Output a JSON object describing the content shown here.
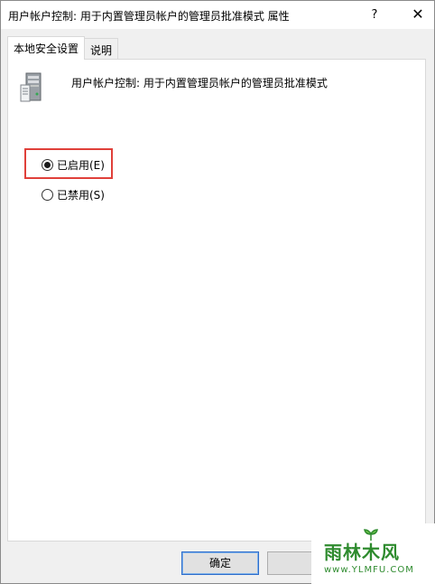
{
  "window": {
    "title": "用户帐户控制: 用于内置管理员帐户的管理员批准模式 属性",
    "help_label": "?",
    "close_label": "✕"
  },
  "tabs": [
    {
      "label": "本地安全设置",
      "active": true
    },
    {
      "label": "说明",
      "active": false
    }
  ],
  "policy": {
    "icon": "server-icon",
    "title": "用户帐户控制: 用于内置管理员帐户的管理员批准模式"
  },
  "options": [
    {
      "label": "已启用(E)",
      "checked": true
    },
    {
      "label": "已禁用(S)",
      "checked": false
    }
  ],
  "buttons": {
    "ok_label": "确定"
  },
  "watermark": {
    "main": "雨林木风",
    "url": "www.YLMFU.COM"
  },
  "colors": {
    "highlight": "#e0403a",
    "watermark": "#2e8b2e",
    "default_button_border": "#2f6dcb"
  }
}
